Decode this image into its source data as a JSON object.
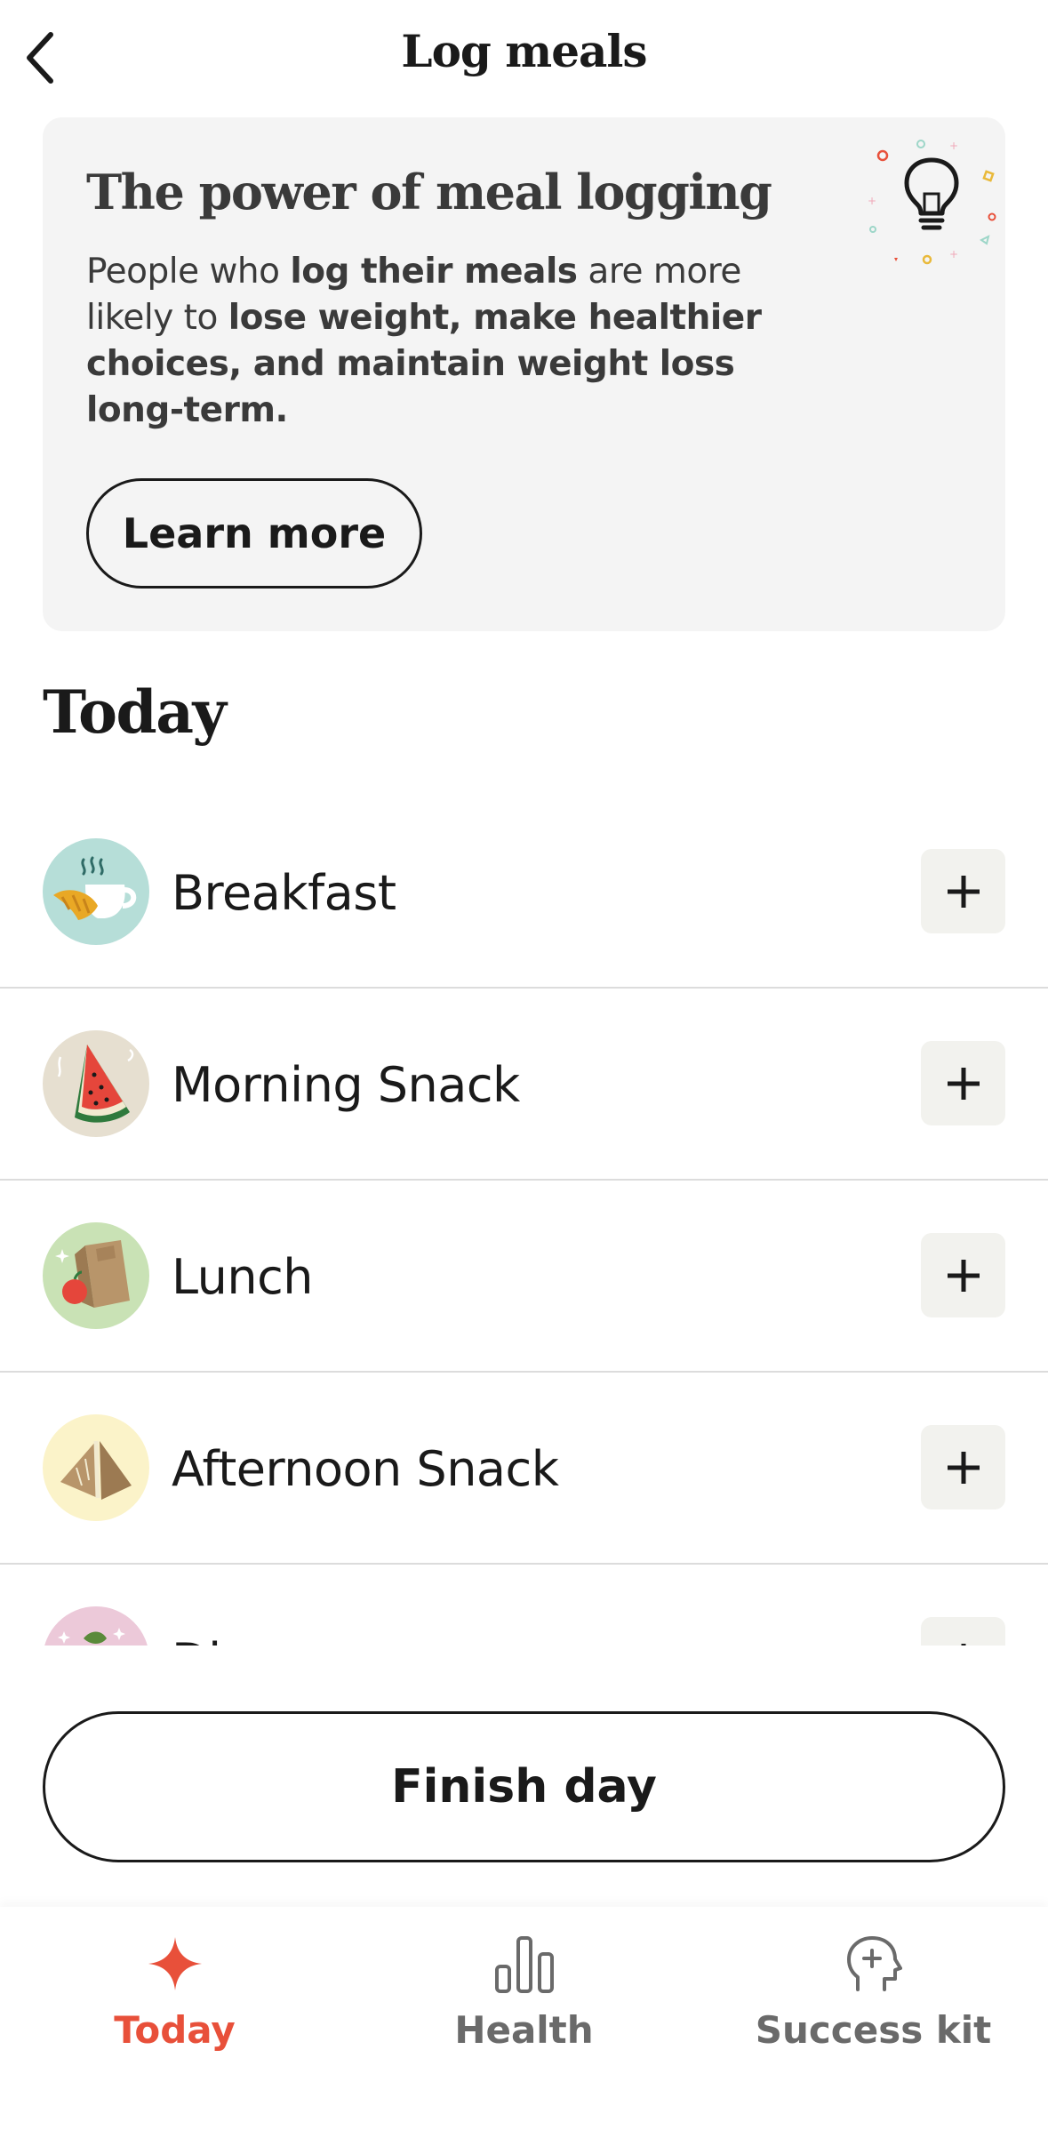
{
  "header": {
    "title": "Log meals"
  },
  "promo": {
    "title": "The power of meal logging",
    "body": [
      {
        "text": "People who ",
        "bold": false
      },
      {
        "text": "log their meals",
        "bold": true
      },
      {
        "text": " are more likely to ",
        "bold": false
      },
      {
        "text": "lose weight, make healthier choices, and maintain weight loss long-term.",
        "bold": true
      }
    ],
    "button_label": "Learn more",
    "icon": "lightbulb-icon"
  },
  "section": {
    "title": "Today"
  },
  "meals": [
    {
      "label": "Breakfast",
      "icon": "croissant-coffee-icon",
      "avatar_color": "#b6ded8"
    },
    {
      "label": "Morning Snack",
      "icon": "watermelon-icon",
      "avatar_color": "#e6dfd0"
    },
    {
      "label": "Lunch",
      "icon": "lunch-bag-icon",
      "avatar_color": "#c9e2b5"
    },
    {
      "label": "Afternoon Snack",
      "icon": "sandwich-icon",
      "avatar_color": "#fbf3c9"
    },
    {
      "label": "Dinner",
      "icon": "dinner-icon",
      "avatar_color": "#ecc9d9"
    }
  ],
  "finish_button": {
    "label": "Finish day"
  },
  "tabs": [
    {
      "label": "Today",
      "icon": "sparkle-icon",
      "active": true
    },
    {
      "label": "Health",
      "icon": "bar-chart-icon",
      "active": false
    },
    {
      "label": "Success kit",
      "icon": "head-plus-icon",
      "active": false
    }
  ],
  "colors": {
    "accent": "#e8503a",
    "card_bg": "#f4f4f4",
    "add_button_bg": "#f2f2ee",
    "divider": "#dcdcdc"
  }
}
